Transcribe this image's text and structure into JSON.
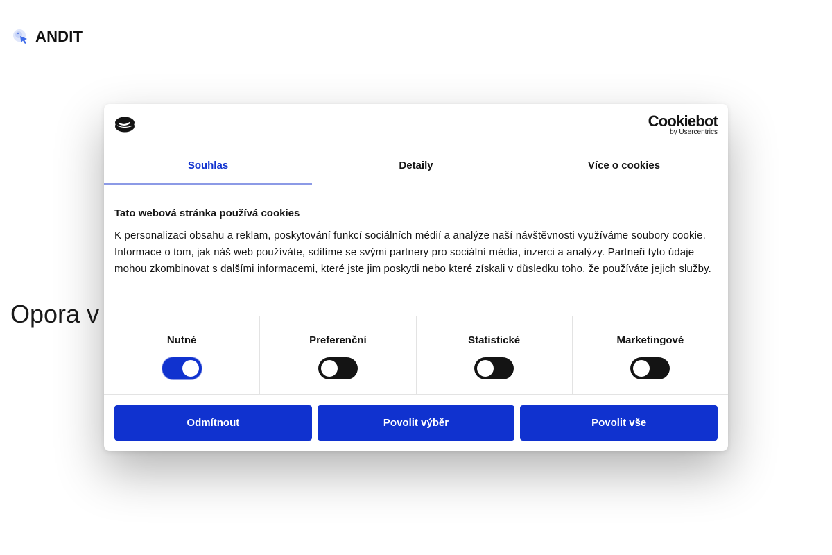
{
  "site": {
    "brand": "ANDIT",
    "hero_text": "Opora v",
    "logo_icon": "cursor-sparkle-icon"
  },
  "cookie_dialog": {
    "brand_name": "Cookiebot",
    "brand_sub": "by Usercentrics",
    "logo_icon": "cookiebot-logo-icon",
    "tabs": [
      {
        "label": "Souhlas",
        "active": true
      },
      {
        "label": "Detaily",
        "active": false
      },
      {
        "label": "Více o cookies",
        "active": false
      }
    ],
    "title": "Tato webová stránka používá cookies",
    "description": "K personalizaci obsahu a reklam, poskytování funkcí sociálních médií a analýze naší návštěvnosti využíváme soubory cookie. Informace o tom, jak náš web používáte, sdílíme se svými partnery pro sociální média, inzerci a analýzy. Partneři tyto údaje mohou zkombinovat s dalšími informacemi, které jste jim poskytli nebo které získali v důsledku toho, že používáte jejich služby.",
    "toggles": [
      {
        "label": "Nutné",
        "on": true
      },
      {
        "label": "Preferenční",
        "on": false
      },
      {
        "label": "Statistické",
        "on": false
      },
      {
        "label": "Marketingové",
        "on": false
      }
    ],
    "buttons": {
      "reject": "Odmítnout",
      "allow_selection": "Povolit výběr",
      "allow_all": "Povolit vše"
    },
    "colors": {
      "accent": "#1032cf",
      "tab_underline": "#8c9ae6",
      "toggle_off": "#141414"
    }
  }
}
